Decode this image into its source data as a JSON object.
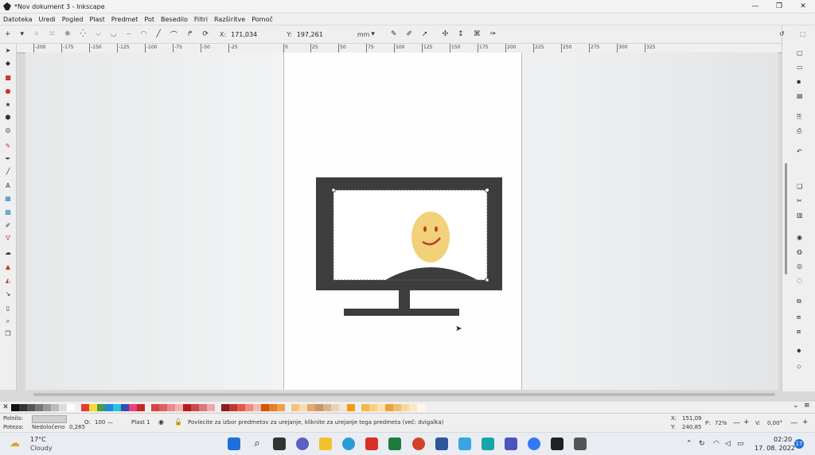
{
  "window": {
    "title": "*Nov dokument 3 - Inkscape",
    "controls": [
      "—",
      "❐",
      "✕"
    ]
  },
  "menu": [
    "Datoteka",
    "Uredi",
    "Pogled",
    "Plast",
    "Predmet",
    "Pot",
    "Besedilo",
    "Filtri",
    "Razširitve",
    "Pomoč"
  ],
  "toolbar": {
    "x_label": "X:",
    "x_value": "171,034",
    "y_label": "Y:",
    "y_value": "197,261",
    "unit": "mm"
  },
  "ruler": [
    "-200",
    "-175",
    "-150",
    "-125",
    "-100",
    "-75",
    "-50",
    "-25",
    "0",
    "25",
    "50",
    "75",
    "100",
    "125",
    "150",
    "175",
    "200",
    "225",
    "250",
    "275",
    "300",
    "325"
  ],
  "palette_colors": [
    "#111111",
    "#333333",
    "#555555",
    "#777777",
    "#999999",
    "#bbbbbb",
    "#dddddd",
    "#ffffff",
    "#e53935",
    "#fdd835",
    "#43a047",
    "#1e88e5",
    "#26c6da",
    "#3949ab",
    "#ec407a",
    "#c62828",
    "#d84343",
    "#e06060",
    "#ea8a8a",
    "#f3b0b0",
    "#b71c1c",
    "#c94a4a",
    "#de7777",
    "#efa8a8",
    "#8e1d1d",
    "#c0392b",
    "#e05a4a",
    "#f08b7b",
    "#f6b8ad",
    "#d35400",
    "#e67e22",
    "#f0a04b",
    "#f6c27f",
    "#fadcb2",
    "#e0a96d",
    "#c89862",
    "#d9b58c",
    "#ead3b6",
    "#f4e6d4",
    "#f39c12",
    "#f7b84b",
    "#fad07c",
    "#fde3ad",
    "#e9a23b",
    "#eec06f",
    "#f4d89e",
    "#f9e8c6",
    "#fff8e8"
  ],
  "status": {
    "fill_label": "Polnilo:",
    "stroke_label": "Poteza:",
    "stroke_value": "Nedoločeno",
    "stroke_width": "0,265",
    "opacity_label": "O:",
    "opacity_value": "100",
    "layer": "Plast 1",
    "message": "Povlecite za izbor predmetov za urejanje, kliknite za urejanje tega predmeta (več: dvigalka)",
    "cursor_x": "151,09",
    "cursor_y": "240,85",
    "zoom_label": "P:",
    "zoom": "72%",
    "rotate_label": "V:",
    "rotation": "0,00°"
  },
  "taskbar": {
    "temperature": "17°C",
    "weather": "Cloudy",
    "time": "02:20",
    "date": "17. 08. 2022",
    "notifications": "17"
  }
}
